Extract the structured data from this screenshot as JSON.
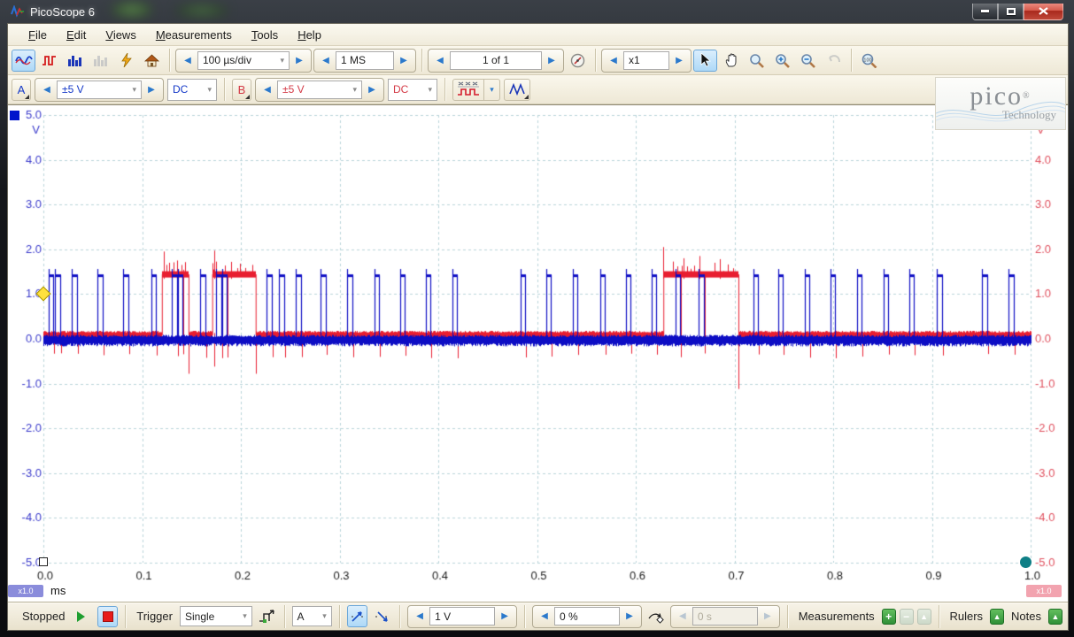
{
  "window": {
    "title": "PicoScope 6"
  },
  "menu": {
    "items": [
      {
        "accel": "F",
        "rest": "ile"
      },
      {
        "accel": "E",
        "rest": "dit"
      },
      {
        "accel": "V",
        "rest": "iews"
      },
      {
        "accel": "M",
        "rest": "easurements"
      },
      {
        "accel": "T",
        "rest": "ools"
      },
      {
        "accel": "H",
        "rest": "elp"
      }
    ]
  },
  "toolbar": {
    "timebase": "100 µs/div",
    "samples": "1 MS",
    "buffer": "1 of 1",
    "zoom": "x1"
  },
  "channels": {
    "a": {
      "label": "A",
      "range": "±5 V",
      "coupling": "DC"
    },
    "b": {
      "label": "B",
      "range": "±5 V",
      "coupling": "DC"
    }
  },
  "logo": {
    "brand": "pico",
    "reg": "®",
    "sub": "Technology"
  },
  "plot": {
    "y_unit": "V",
    "x_unit": "ms",
    "left_scale_badge": "x1.0",
    "right_scale_badge": "x1.0"
  },
  "statusbar": {
    "run_state": "Stopped",
    "trigger_label": "Trigger",
    "trigger_mode": "Single",
    "trigger_source": "A",
    "trigger_level": "1 V",
    "trigger_position": "0 %",
    "trigger_delay": "0 s",
    "measurements_label": "Measurements",
    "rulers_label": "Rulers",
    "notes_label": "Notes"
  },
  "icons": {
    "spin_left": "◀",
    "spin_right": "▶",
    "caret_down": "▾",
    "plus": "+",
    "minus": "−",
    "up_arrow": "▲"
  },
  "chart_data": {
    "type": "line",
    "title": "",
    "xlabel": "ms",
    "ylabel": "V",
    "x_range": [
      0.0,
      1.0
    ],
    "y_range": [
      -5.0,
      5.0
    ],
    "x_ticks": [
      0.0,
      0.1,
      0.2,
      0.3,
      0.4,
      0.5,
      0.6,
      0.7,
      0.8,
      0.9,
      1.0
    ],
    "y_ticks": [
      -5,
      -4,
      -3,
      -2,
      -1,
      0,
      1,
      2,
      3,
      4,
      5
    ],
    "grid": "dashed",
    "grid_color": "#b9d4da",
    "axis_colors": {
      "left": "#3a3acb",
      "right": "#e0505e",
      "bottom": "#1a1a1a"
    },
    "legend": "none",
    "trigger": {
      "source": "A",
      "level_v": 1.0,
      "time_ms": 0.0
    },
    "series": [
      {
        "name": "A",
        "color": "#0d0dc4",
        "kind": "pulse-train",
        "baseline_v": -0.03,
        "noise_v": 0.1,
        "high_v": 1.42,
        "overshoot_v": 1.56,
        "pulse_width_ms": 0.005,
        "pulse_times_ms": [
          0.005,
          0.012,
          0.029,
          0.055,
          0.081,
          0.109,
          0.13,
          0.136,
          0.159,
          0.175,
          0.181,
          0.226,
          0.239,
          0.256,
          0.281,
          0.308,
          0.335,
          0.361,
          0.387,
          0.414,
          0.483,
          0.509,
          0.536,
          0.564,
          0.59,
          0.616,
          0.64,
          0.664,
          0.719,
          0.744,
          0.771,
          0.797,
          0.824,
          0.851,
          0.877,
          0.905,
          0.951,
          0.978
        ]
      },
      {
        "name": "B",
        "color": "#e81e30",
        "kind": "burst",
        "baseline_v": 0.08,
        "noise_v": 0.08,
        "high_v": 1.44,
        "bursts_ms": [
          [
            0.12,
            0.147
          ],
          [
            0.171,
            0.215
          ],
          [
            0.628,
            0.704
          ]
        ],
        "spikes_up": [
          {
            "t": 0.122,
            "v": 1.95
          },
          {
            "t": 0.135,
            "v": 1.75
          },
          {
            "t": 0.173,
            "v": 1.97
          },
          {
            "t": 0.19,
            "v": 1.72
          },
          {
            "t": 0.628,
            "v": 2.05
          },
          {
            "t": 0.648,
            "v": 1.8
          },
          {
            "t": 0.665,
            "v": 1.85
          },
          {
            "t": 0.685,
            "v": 1.78
          }
        ],
        "spikes_down": [
          {
            "t": 0.147,
            "v": -0.78
          },
          {
            "t": 0.173,
            "v": -0.62
          },
          {
            "t": 0.215,
            "v": -0.78
          },
          {
            "t": 0.704,
            "v": -1.12
          }
        ],
        "pulse_tick_down_v": -0.32
      }
    ]
  }
}
